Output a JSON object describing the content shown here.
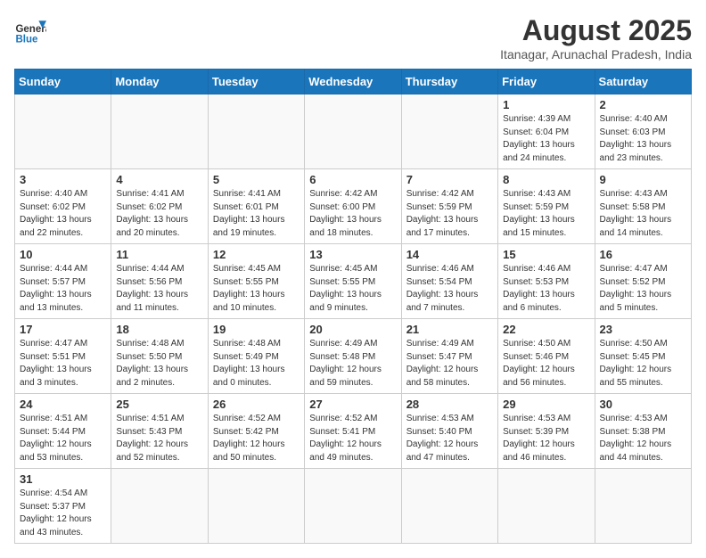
{
  "header": {
    "logo_general": "General",
    "logo_blue": "Blue",
    "month_title": "August 2025",
    "subtitle": "Itanagar, Arunachal Pradesh, India"
  },
  "weekdays": [
    "Sunday",
    "Monday",
    "Tuesday",
    "Wednesday",
    "Thursday",
    "Friday",
    "Saturday"
  ],
  "weeks": [
    [
      {
        "day": "",
        "info": ""
      },
      {
        "day": "",
        "info": ""
      },
      {
        "day": "",
        "info": ""
      },
      {
        "day": "",
        "info": ""
      },
      {
        "day": "",
        "info": ""
      },
      {
        "day": "1",
        "info": "Sunrise: 4:39 AM\nSunset: 6:04 PM\nDaylight: 13 hours and 24 minutes."
      },
      {
        "day": "2",
        "info": "Sunrise: 4:40 AM\nSunset: 6:03 PM\nDaylight: 13 hours and 23 minutes."
      }
    ],
    [
      {
        "day": "3",
        "info": "Sunrise: 4:40 AM\nSunset: 6:02 PM\nDaylight: 13 hours and 22 minutes."
      },
      {
        "day": "4",
        "info": "Sunrise: 4:41 AM\nSunset: 6:02 PM\nDaylight: 13 hours and 20 minutes."
      },
      {
        "day": "5",
        "info": "Sunrise: 4:41 AM\nSunset: 6:01 PM\nDaylight: 13 hours and 19 minutes."
      },
      {
        "day": "6",
        "info": "Sunrise: 4:42 AM\nSunset: 6:00 PM\nDaylight: 13 hours and 18 minutes."
      },
      {
        "day": "7",
        "info": "Sunrise: 4:42 AM\nSunset: 5:59 PM\nDaylight: 13 hours and 17 minutes."
      },
      {
        "day": "8",
        "info": "Sunrise: 4:43 AM\nSunset: 5:59 PM\nDaylight: 13 hours and 15 minutes."
      },
      {
        "day": "9",
        "info": "Sunrise: 4:43 AM\nSunset: 5:58 PM\nDaylight: 13 hours and 14 minutes."
      }
    ],
    [
      {
        "day": "10",
        "info": "Sunrise: 4:44 AM\nSunset: 5:57 PM\nDaylight: 13 hours and 13 minutes."
      },
      {
        "day": "11",
        "info": "Sunrise: 4:44 AM\nSunset: 5:56 PM\nDaylight: 13 hours and 11 minutes."
      },
      {
        "day": "12",
        "info": "Sunrise: 4:45 AM\nSunset: 5:55 PM\nDaylight: 13 hours and 10 minutes."
      },
      {
        "day": "13",
        "info": "Sunrise: 4:45 AM\nSunset: 5:55 PM\nDaylight: 13 hours and 9 minutes."
      },
      {
        "day": "14",
        "info": "Sunrise: 4:46 AM\nSunset: 5:54 PM\nDaylight: 13 hours and 7 minutes."
      },
      {
        "day": "15",
        "info": "Sunrise: 4:46 AM\nSunset: 5:53 PM\nDaylight: 13 hours and 6 minutes."
      },
      {
        "day": "16",
        "info": "Sunrise: 4:47 AM\nSunset: 5:52 PM\nDaylight: 13 hours and 5 minutes."
      }
    ],
    [
      {
        "day": "17",
        "info": "Sunrise: 4:47 AM\nSunset: 5:51 PM\nDaylight: 13 hours and 3 minutes."
      },
      {
        "day": "18",
        "info": "Sunrise: 4:48 AM\nSunset: 5:50 PM\nDaylight: 13 hours and 2 minutes."
      },
      {
        "day": "19",
        "info": "Sunrise: 4:48 AM\nSunset: 5:49 PM\nDaylight: 13 hours and 0 minutes."
      },
      {
        "day": "20",
        "info": "Sunrise: 4:49 AM\nSunset: 5:48 PM\nDaylight: 12 hours and 59 minutes."
      },
      {
        "day": "21",
        "info": "Sunrise: 4:49 AM\nSunset: 5:47 PM\nDaylight: 12 hours and 58 minutes."
      },
      {
        "day": "22",
        "info": "Sunrise: 4:50 AM\nSunset: 5:46 PM\nDaylight: 12 hours and 56 minutes."
      },
      {
        "day": "23",
        "info": "Sunrise: 4:50 AM\nSunset: 5:45 PM\nDaylight: 12 hours and 55 minutes."
      }
    ],
    [
      {
        "day": "24",
        "info": "Sunrise: 4:51 AM\nSunset: 5:44 PM\nDaylight: 12 hours and 53 minutes."
      },
      {
        "day": "25",
        "info": "Sunrise: 4:51 AM\nSunset: 5:43 PM\nDaylight: 12 hours and 52 minutes."
      },
      {
        "day": "26",
        "info": "Sunrise: 4:52 AM\nSunset: 5:42 PM\nDaylight: 12 hours and 50 minutes."
      },
      {
        "day": "27",
        "info": "Sunrise: 4:52 AM\nSunset: 5:41 PM\nDaylight: 12 hours and 49 minutes."
      },
      {
        "day": "28",
        "info": "Sunrise: 4:53 AM\nSunset: 5:40 PM\nDaylight: 12 hours and 47 minutes."
      },
      {
        "day": "29",
        "info": "Sunrise: 4:53 AM\nSunset: 5:39 PM\nDaylight: 12 hours and 46 minutes."
      },
      {
        "day": "30",
        "info": "Sunrise: 4:53 AM\nSunset: 5:38 PM\nDaylight: 12 hours and 44 minutes."
      }
    ],
    [
      {
        "day": "31",
        "info": "Sunrise: 4:54 AM\nSunset: 5:37 PM\nDaylight: 12 hours and 43 minutes."
      },
      {
        "day": "",
        "info": ""
      },
      {
        "day": "",
        "info": ""
      },
      {
        "day": "",
        "info": ""
      },
      {
        "day": "",
        "info": ""
      },
      {
        "day": "",
        "info": ""
      },
      {
        "day": "",
        "info": ""
      }
    ]
  ]
}
